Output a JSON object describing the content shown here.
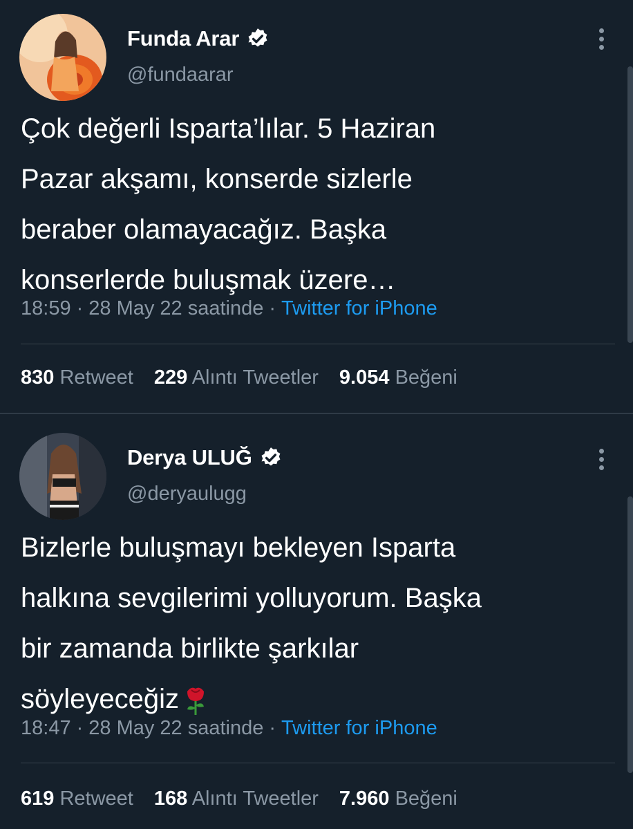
{
  "tweets": [
    {
      "name": "Funda Arar",
      "handle": "@fundaarar",
      "text": "Çok değerli Isparta’lılar. 5 Haziran\nPazar akşamı, konserde sizlerle\nberaber olamayacağız. Başka\nkonserlerde buluşmak üzere…",
      "time": "18:59",
      "date": "28 May 22 saatinde",
      "dot": "·",
      "source": "Twitter for iPhone",
      "retweets": "830",
      "retweets_label": "Retweet",
      "quotes": "229",
      "quotes_label": "Alıntı Tweetler",
      "likes": "9.054",
      "likes_label": "Beğeni",
      "avatar_icon": "avatar-photo-flowers",
      "verified_icon": "verified-badge-icon"
    },
    {
      "name": "Derya ULUĞ",
      "handle": "@deryaulugg",
      "text": "Bizlerle buluşmayı bekleyen Isparta\nhalkına sevgilerimi yolluyorum. Başka\nbir zamanda birlikte şarkılar\nsöyleyeceğiz",
      "emoji": "rose-emoji",
      "time": "18:47",
      "date": "28 May 22 saatinde",
      "dot": "·",
      "source": "Twitter for iPhone",
      "retweets": "619",
      "retweets_label": "Retweet",
      "quotes": "168",
      "quotes_label": "Alıntı Tweetler",
      "likes": "7.960",
      "likes_label": "Beğeni",
      "avatar_icon": "avatar-photo",
      "verified_icon": "verified-badge-icon"
    }
  ],
  "colors": {
    "background": "#15202b",
    "text": "#ffffff",
    "muted": "#8b98a5",
    "link": "#1d9bf0",
    "divider": "#38444d"
  }
}
